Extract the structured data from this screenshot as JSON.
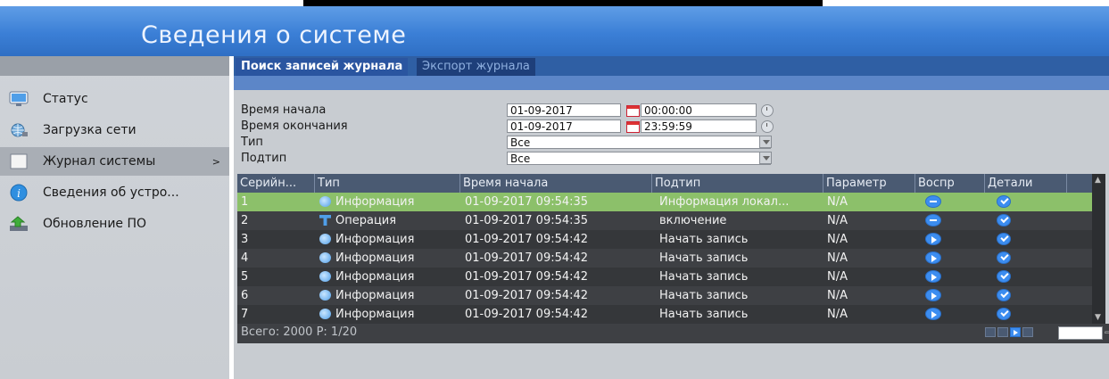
{
  "window": {
    "title": "Сведения о системе"
  },
  "sidebar": {
    "items": [
      {
        "label": "Статус",
        "icon": "monitor-icon",
        "active": false
      },
      {
        "label": "Загрузка сети",
        "icon": "network-globe-icon",
        "active": false
      },
      {
        "label": "Журнал системы",
        "icon": "log-book-icon",
        "active": true,
        "arrow": ">"
      },
      {
        "label": "Сведения об устро...",
        "icon": "info-icon",
        "active": false
      },
      {
        "label": "Обновление ПО",
        "icon": "upgrade-arrow-icon",
        "active": false
      }
    ]
  },
  "tabs": {
    "search": "Поиск записей журнала",
    "export": "Экспорт журнала"
  },
  "form": {
    "start_label": "Время начала",
    "end_label": "Время окончания",
    "type_label": "Тип",
    "subtype_label": "Подтип",
    "start_date": "01-09-2017",
    "start_time": "00:00:00",
    "end_date": "01-09-2017",
    "end_time": "23:59:59",
    "type_value": "Все",
    "subtype_value": "Все"
  },
  "table": {
    "columns": [
      "Серийн...",
      "Тип",
      "Время начала",
      "Подтип",
      "Параметр",
      "Воспр",
      "Детали"
    ],
    "rows": [
      {
        "num": "1",
        "type": "Информация",
        "time": "01-09-2017 09:54:35",
        "subtype": "Информация локал...",
        "param": "N/A",
        "play": "dash"
      },
      {
        "num": "2",
        "type": "Операция",
        "time": "01-09-2017 09:54:35",
        "subtype": "включение",
        "param": "N/A",
        "play": "dash"
      },
      {
        "num": "3",
        "type": "Информация",
        "time": "01-09-2017 09:54:42",
        "subtype": "Начать запись",
        "param": "N/A",
        "play": "play"
      },
      {
        "num": "4",
        "type": "Информация",
        "time": "01-09-2017 09:54:42",
        "subtype": "Начать запись",
        "param": "N/A",
        "play": "play"
      },
      {
        "num": "5",
        "type": "Информация",
        "time": "01-09-2017 09:54:42",
        "subtype": "Начать запись",
        "param": "N/A",
        "play": "play"
      },
      {
        "num": "6",
        "type": "Информация",
        "time": "01-09-2017 09:54:42",
        "subtype": "Начать запись",
        "param": "N/A",
        "play": "play"
      },
      {
        "num": "7",
        "type": "Информация",
        "time": "01-09-2017 09:54:42",
        "subtype": "Начать запись",
        "param": "N/A",
        "play": "play"
      }
    ]
  },
  "footer": {
    "total": "Всего: 2000  P: 1/20"
  },
  "colors": {
    "header_blue": "#3b7fd6",
    "selected_row": "#8cc06a",
    "action_blue": "#3c8df0"
  }
}
